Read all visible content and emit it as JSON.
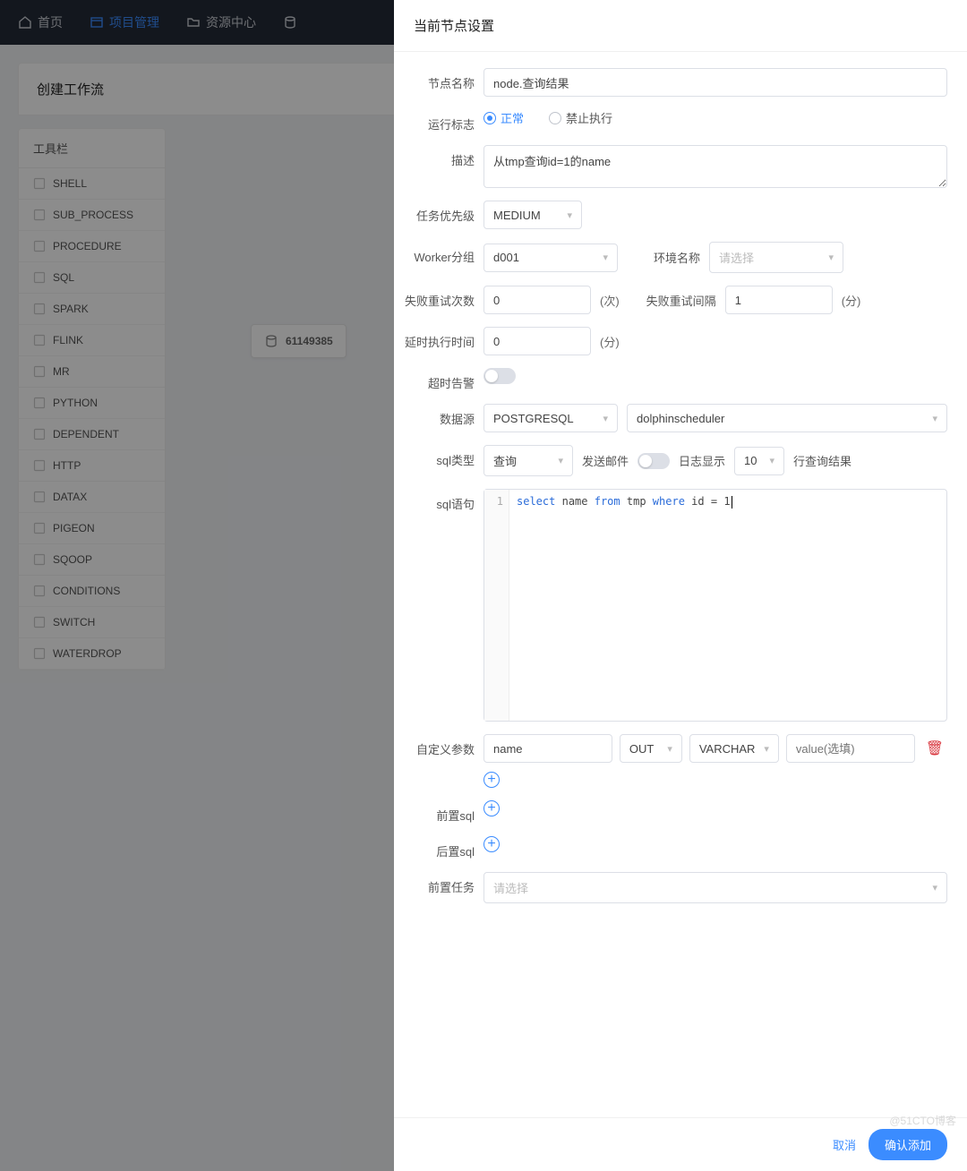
{
  "topnav": {
    "items": [
      {
        "label": "首页",
        "icon": "home"
      },
      {
        "label": "项目管理",
        "icon": "project",
        "active": true
      },
      {
        "label": "资源中心",
        "icon": "folder"
      }
    ]
  },
  "page": {
    "title": "创建工作流",
    "toolbox_title": "工具栏",
    "tools": [
      "SHELL",
      "SUB_PROCESS",
      "PROCEDURE",
      "SQL",
      "SPARK",
      "FLINK",
      "MR",
      "PYTHON",
      "DEPENDENT",
      "HTTP",
      "DATAX",
      "PIGEON",
      "SQOOP",
      "CONDITIONS",
      "SWITCH",
      "WATERDROP"
    ],
    "canvas_node": {
      "icon_label": "SQL",
      "id_text": "61149385"
    }
  },
  "drawer": {
    "title": "当前节点设置",
    "labels": {
      "node_name": "节点名称",
      "run_flag": "运行标志",
      "desc": "描述",
      "priority": "任务优先级",
      "worker_group": "Worker分组",
      "env_name": "环境名称",
      "fail_retry_times": "失败重试次数",
      "fail_retry_interval": "失败重试间隔",
      "delay_time": "延时执行时间",
      "timeout_alarm": "超时告警",
      "datasource": "数据源",
      "sql_type": "sql类型",
      "send_mail": "发送邮件",
      "log_display": "日志显示",
      "log_rows_suffix": "行查询结果",
      "sql_stmt": "sql语句",
      "custom_params": "自定义参数",
      "pre_sql": "前置sql",
      "post_sql": "后置sql",
      "pre_tasks": "前置任务"
    },
    "values": {
      "node_name": "node.查询结果",
      "run_flag_options": {
        "normal": "正常",
        "forbid": "禁止执行"
      },
      "run_flag_selected": "normal",
      "desc": "从tmp查询id=1的name",
      "priority": "MEDIUM",
      "worker_group": "d001",
      "env_name_placeholder": "请选择",
      "fail_retry_times": "0",
      "fail_retry_times_unit": "(次)",
      "fail_retry_interval": "1",
      "fail_retry_interval_unit": "(分)",
      "delay_time": "0",
      "delay_time_unit": "(分)",
      "timeout_alarm_on": false,
      "datasource_type": "POSTGRESQL",
      "datasource_name": "dolphinscheduler",
      "sql_type": "查询",
      "send_mail_on": false,
      "log_rows": "10",
      "sql_line_no": "1",
      "sql_tokens": [
        {
          "t": "kw",
          "v": "select"
        },
        {
          "t": "sp"
        },
        {
          "t": "id",
          "v": "name"
        },
        {
          "t": "sp"
        },
        {
          "t": "kw",
          "v": "from"
        },
        {
          "t": "sp"
        },
        {
          "t": "id",
          "v": "tmp"
        },
        {
          "t": "sp"
        },
        {
          "t": "kw",
          "v": "where"
        },
        {
          "t": "sp"
        },
        {
          "t": "id",
          "v": "id"
        },
        {
          "t": "sp"
        },
        {
          "t": "op",
          "v": "="
        },
        {
          "t": "sp"
        },
        {
          "t": "num",
          "v": "1"
        }
      ],
      "custom_param": {
        "name": "name",
        "direction": "OUT",
        "type": "VARCHAR",
        "value_placeholder": "value(选填)"
      },
      "pre_tasks_placeholder": "请选择"
    },
    "footer": {
      "cancel": "取消",
      "confirm": "确认添加"
    }
  },
  "watermark": "@51CTO博客"
}
